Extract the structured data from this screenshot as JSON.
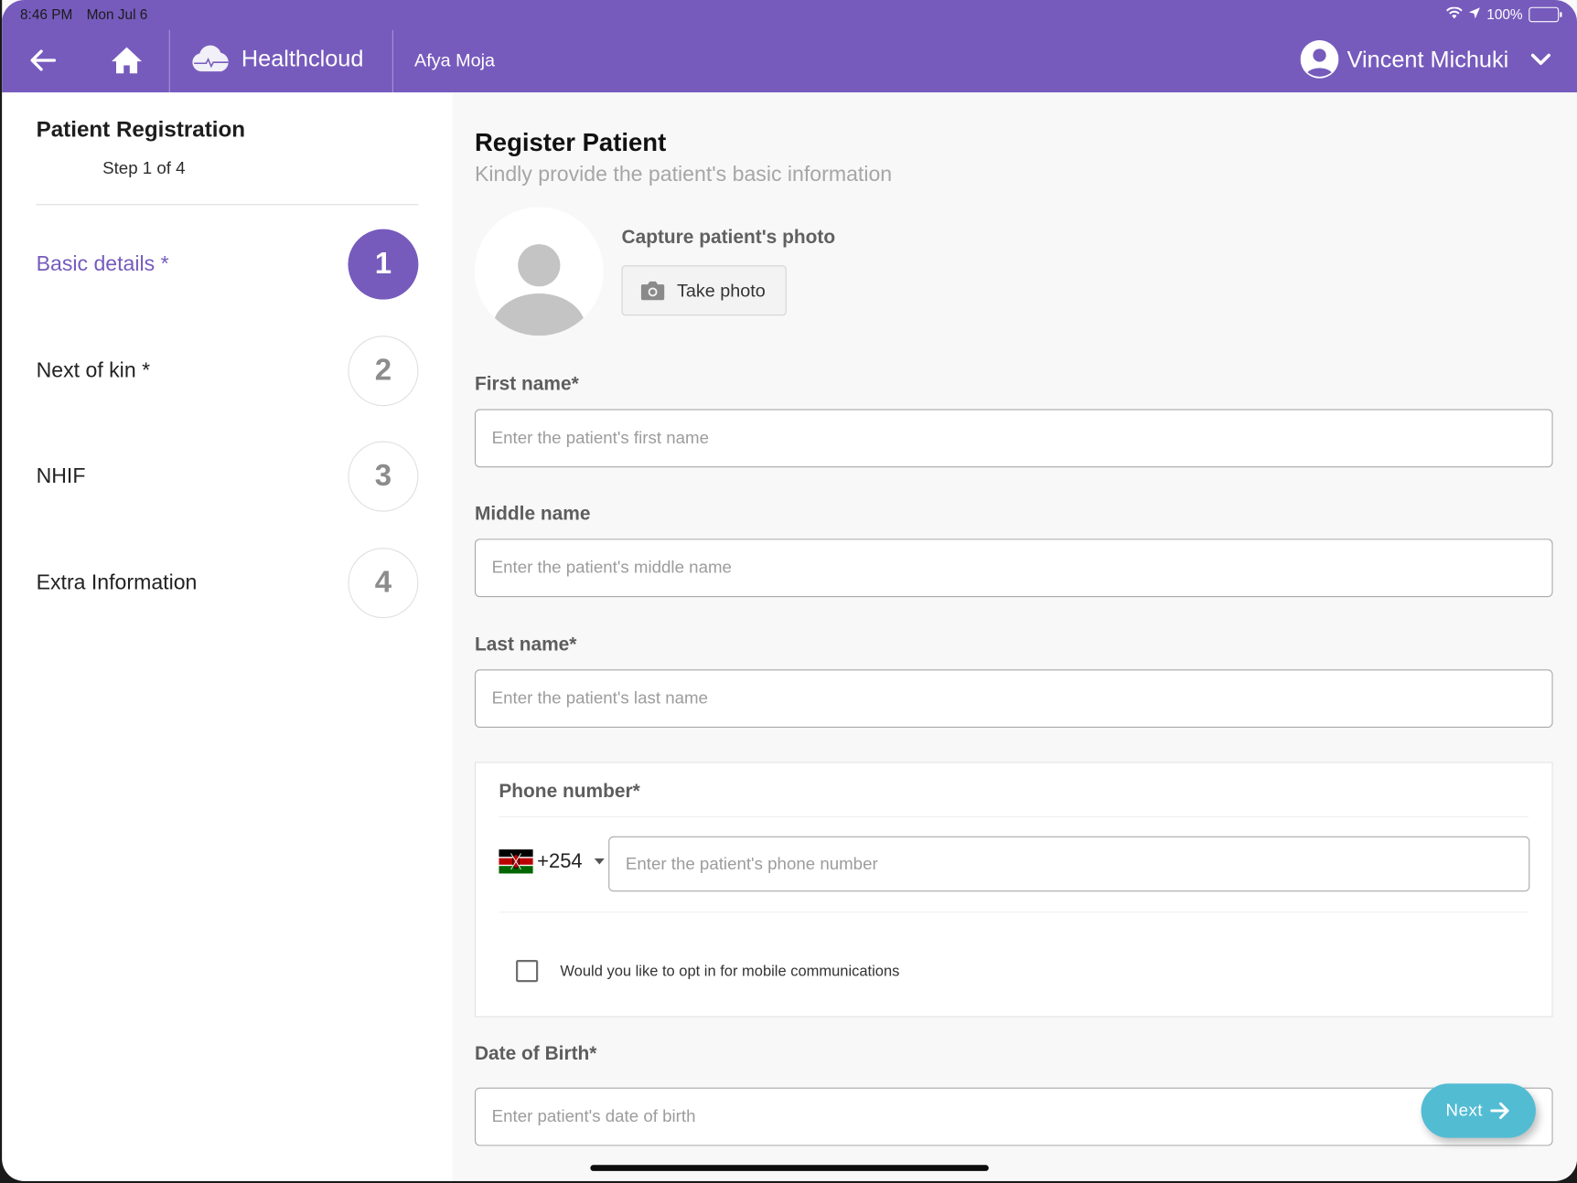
{
  "status_bar": {
    "time": "8:46 PM",
    "date": "Mon Jul 6",
    "battery": "100%",
    "icons": [
      "wifi-icon",
      "location-arrow-icon",
      "battery-icon"
    ]
  },
  "header": {
    "back_icon": "arrow-left-icon",
    "home_icon": "home-icon",
    "brand_icon": "cloud-pulse-icon",
    "brand_name": "Healthcloud",
    "org_name": "Afya Moja",
    "user_name": "Vincent Michuki",
    "user_icon": "user-avatar-icon",
    "menu_icon": "chevron-down-icon"
  },
  "sidebar": {
    "title": "Patient Registration",
    "subtitle": "Step 1 of 4",
    "steps": [
      {
        "label": "Basic details *",
        "number": "1",
        "active": true
      },
      {
        "label": "Next of kin *",
        "number": "2",
        "active": false
      },
      {
        "label": "NHIF",
        "number": "3",
        "active": false
      },
      {
        "label": "Extra Information",
        "number": "4",
        "active": false
      }
    ]
  },
  "main": {
    "title": "Register Patient",
    "subtitle": "Kindly provide the patient's basic information",
    "photo": {
      "label": "Capture patient's photo",
      "button_label": "Take photo",
      "button_icon": "camera-icon"
    },
    "fields": {
      "first_name": {
        "label": "First name*",
        "placeholder": "Enter the patient's first name",
        "value": ""
      },
      "middle_name": {
        "label": "Middle name",
        "placeholder": "Enter the patient's middle name",
        "value": ""
      },
      "last_name": {
        "label": "Last name*",
        "placeholder": "Enter the patient's last name",
        "value": ""
      },
      "phone": {
        "label": "Phone number*",
        "country_flag": "kenya-flag",
        "country_code": "+254",
        "placeholder": "Enter the patient's phone number",
        "value": "",
        "opt_in_label": "Would you like to opt in for mobile communications",
        "opt_in_checked": false
      },
      "dob": {
        "label": "Date of Birth*",
        "placeholder": "Enter patient's date of birth",
        "value": ""
      }
    },
    "next_button": {
      "label": "Next",
      "icon": "arrow-right-icon"
    }
  },
  "colors": {
    "brand_purple": "#765bbd",
    "next_button": "#52bcd3",
    "inactive_text": "#8c8c8c"
  }
}
